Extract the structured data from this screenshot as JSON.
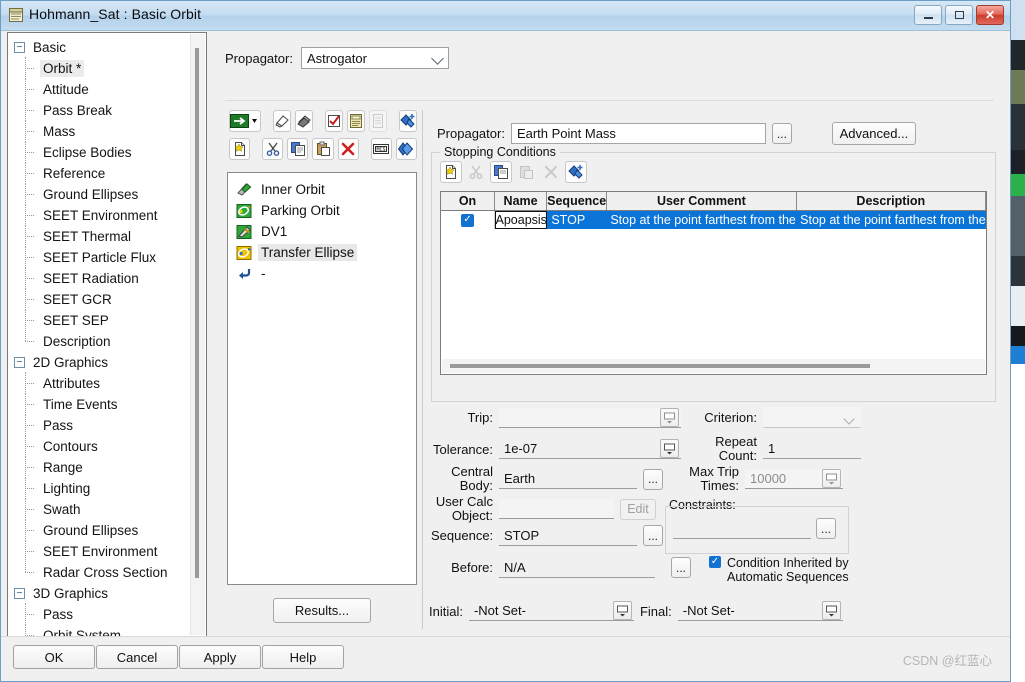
{
  "window": {
    "title": "Hohmann_Sat : Basic Orbit",
    "icon": "notepad-icon",
    "minimize": "–",
    "maximize": "□",
    "close": "✕"
  },
  "tree": {
    "groups": [
      {
        "label": "Basic",
        "expander": "−",
        "items": [
          {
            "label": "Orbit *",
            "selected": true
          },
          {
            "label": "Attitude"
          },
          {
            "label": "Pass Break"
          },
          {
            "label": "Mass"
          },
          {
            "label": "Eclipse Bodies"
          },
          {
            "label": "Reference"
          },
          {
            "label": "Ground Ellipses"
          },
          {
            "label": "SEET Environment"
          },
          {
            "label": "SEET Thermal"
          },
          {
            "label": "SEET Particle Flux"
          },
          {
            "label": "SEET Radiation"
          },
          {
            "label": "SEET GCR"
          },
          {
            "label": "SEET SEP"
          },
          {
            "label": "Description"
          }
        ]
      },
      {
        "label": "2D Graphics",
        "expander": "−",
        "items": [
          {
            "label": "Attributes"
          },
          {
            "label": "Time Events"
          },
          {
            "label": "Pass"
          },
          {
            "label": "Contours"
          },
          {
            "label": "Range"
          },
          {
            "label": "Lighting"
          },
          {
            "label": "Swath"
          },
          {
            "label": "Ground Ellipses"
          },
          {
            "label": "SEET Environment"
          },
          {
            "label": "Radar Cross Section"
          }
        ]
      },
      {
        "label": "3D Graphics",
        "expander": "−",
        "items": [
          {
            "label": "Pass"
          },
          {
            "label": "Orbit System"
          }
        ]
      }
    ]
  },
  "propagator_top": {
    "label": "Propagator:",
    "value": "Astrogator"
  },
  "mcs": {
    "toolbar_row1": [
      {
        "name": "run-mcs-button",
        "icon": "green-arrow-run-icon"
      },
      {
        "name": "run-dropdown-button",
        "icon": "caret-down-icon"
      },
      {
        "name": "clear-graphics-button",
        "icon": "eraser-icon"
      },
      {
        "name": "clear-all-button",
        "icon": "stack-clear-icon"
      },
      {
        "name": "toggle-enable-button",
        "icon": "checkbox-checked-icon"
      },
      {
        "name": "summary-button",
        "icon": "yellow-note-icon"
      },
      {
        "name": "report-button",
        "icon": "grey-note-icon",
        "disabled": true
      },
      {
        "name": "insert-segment-button",
        "icon": "blue-diamond-plus-icon"
      }
    ],
    "toolbar_row2": [
      {
        "name": "new-segment-button",
        "icon": "new-doc-star-icon"
      },
      {
        "name": "cut-button",
        "icon": "scissors-icon"
      },
      {
        "name": "copy-button",
        "icon": "copy-pages-icon"
      },
      {
        "name": "paste-button",
        "icon": "clipboard-icon"
      },
      {
        "name": "delete-button",
        "icon": "red-x-icon"
      },
      {
        "name": "mcs-options-button",
        "icon": "mcs-box-icon"
      },
      {
        "name": "apply-segment-button",
        "icon": "blue-diamond-icon"
      }
    ],
    "items": [
      {
        "label": "Inner Orbit",
        "icon": "initial-state-icon",
        "selected": false
      },
      {
        "label": "Parking Orbit",
        "icon": "propagate-icon",
        "selected": false
      },
      {
        "label": "DV1",
        "icon": "maneuver-icon",
        "selected": false
      },
      {
        "label": "Transfer Ellipse",
        "icon": "propagate-icon",
        "selected": true
      },
      {
        "label": "-",
        "icon": "return-arrow-icon",
        "selected": false
      }
    ],
    "results_button": "Results..."
  },
  "detail": {
    "propagator": {
      "label": "Propagator:",
      "value": "Earth Point Mass",
      "browse": "...",
      "advanced_button": "Advanced..."
    },
    "stopping_conditions": {
      "title": "Stopping Conditions",
      "toolbar": [
        {
          "name": "new-condition-button",
          "icon": "new-doc-star-icon"
        },
        {
          "name": "cut-condition-button",
          "icon": "scissors-icon",
          "disabled": true
        },
        {
          "name": "copy-condition-button",
          "icon": "copy-pages-icon"
        },
        {
          "name": "paste-condition-button",
          "icon": "clipboard-icon",
          "disabled": true
        },
        {
          "name": "delete-condition-button",
          "icon": "grey-x-icon",
          "disabled": true
        },
        {
          "name": "add-condition-button",
          "icon": "blue-diamond-plus-icon"
        }
      ],
      "columns": [
        "On",
        "Name",
        "Sequence",
        "User Comment",
        "Description"
      ],
      "rows": [
        {
          "on": true,
          "name": "Apoapsis",
          "sequence": "STOP",
          "user_comment": "Stop at the point farthest from the origin",
          "description": "Stop at the point farthest from the orig"
        }
      ]
    },
    "fields": {
      "trip": {
        "label": "Trip:",
        "value": "",
        "disabled": true
      },
      "criterion": {
        "label": "Criterion:",
        "value": "",
        "disabled": true
      },
      "tolerance": {
        "label": "Tolerance:",
        "value": "1e-07"
      },
      "repeat_count": {
        "label": "Repeat\nCount:",
        "label_line1": "Repeat",
        "label_line2": "Count:",
        "value": "1"
      },
      "central_body": {
        "label_line1": "Central",
        "label_line2": "Body:",
        "value": "Earth",
        "browse": "..."
      },
      "max_trip_times": {
        "label_line1": "Max Trip",
        "label_line2": "Times:",
        "value": "10000",
        "disabled": true
      },
      "user_calc_object": {
        "label_line1": "User Calc",
        "label_line2": "Object:",
        "value": "",
        "edit_button": "Edit",
        "disabled": true
      },
      "constraints": {
        "label": "Constraints:",
        "value": "",
        "browse": "..."
      },
      "sequence": {
        "label": "Sequence:",
        "value": "STOP",
        "browse": "..."
      },
      "before": {
        "label": "Before:",
        "value": "N/A",
        "browse": "..."
      },
      "condition_inherited": {
        "checked": true,
        "line1": "Condition Inherited by",
        "line2": "Automatic Sequences"
      }
    },
    "bottom": {
      "initial_label": "Initial:",
      "initial_value": "-Not Set-",
      "final_label": "Final:",
      "final_value": "-Not Set-"
    }
  },
  "footer": {
    "ok": "OK",
    "cancel": "Cancel",
    "apply": "Apply",
    "help": "Help"
  },
  "watermark": "CSDN @红蓝心",
  "colors": {
    "selection_blue": "#0a74d8",
    "checkbox_blue": "#1272d1",
    "titlebar_blue": "#b2d1ea",
    "close_red": "#cc3c2c"
  }
}
